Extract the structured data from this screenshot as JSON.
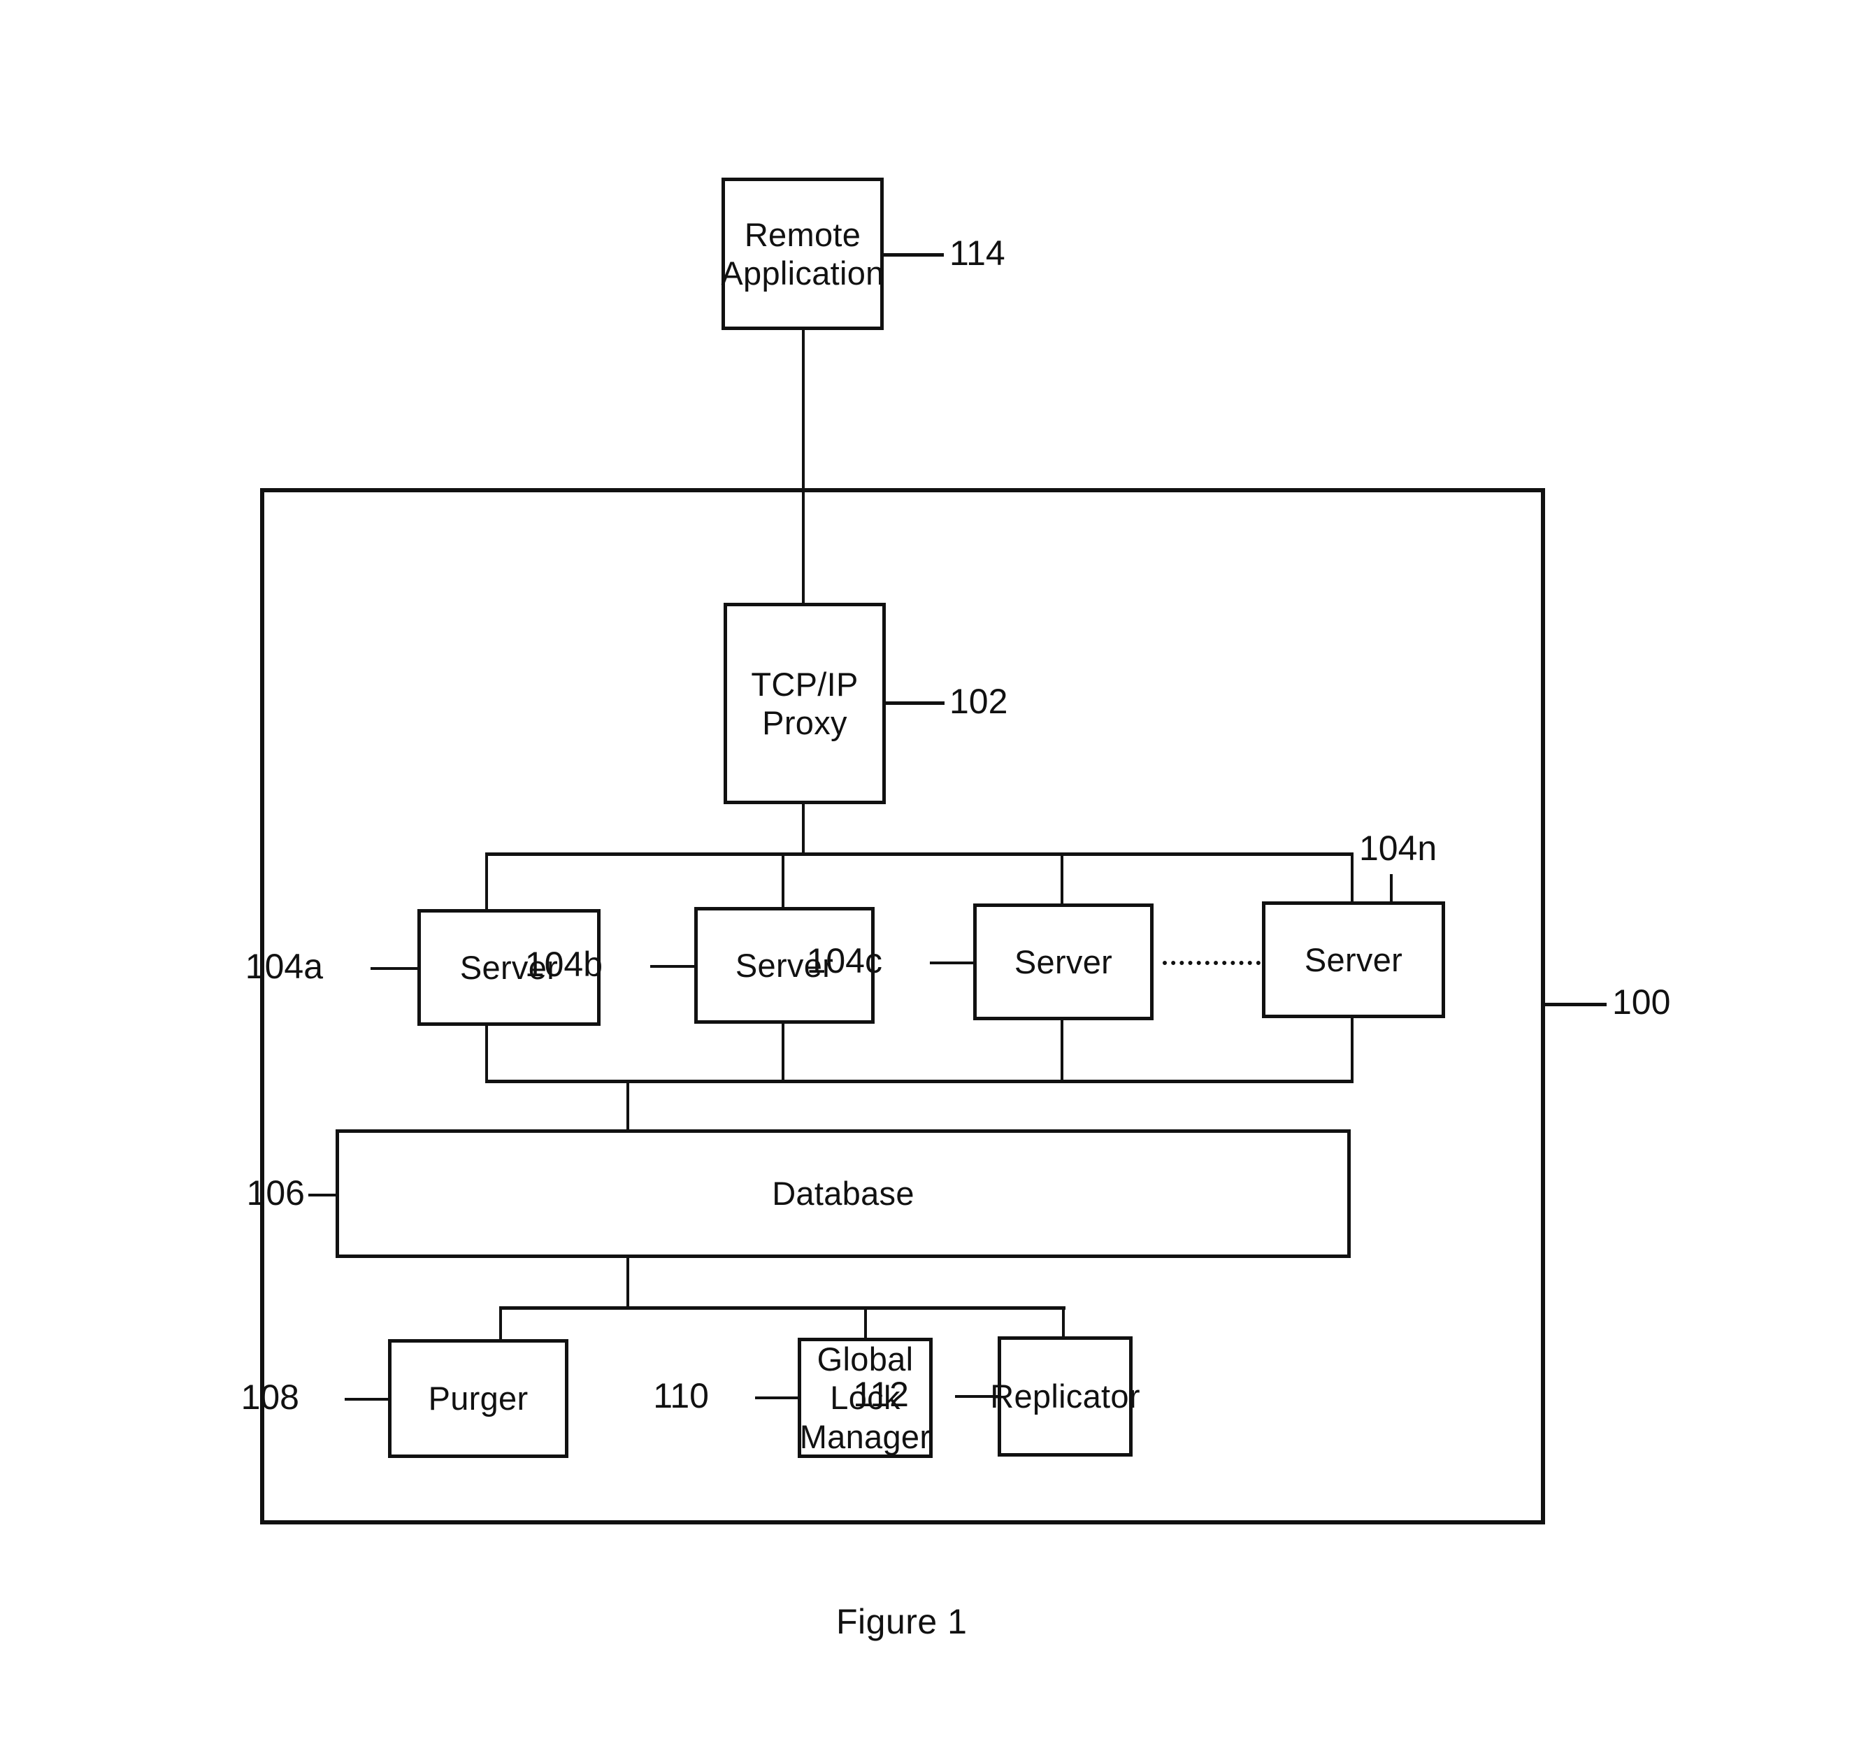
{
  "figure": {
    "caption": "Figure 1",
    "system_ref": "100"
  },
  "nodes": {
    "remote_application": {
      "label": "Remote\nApplication",
      "ref": "114"
    },
    "tcp_ip_proxy": {
      "label": "TCP/IP Proxy",
      "ref": "102"
    },
    "servers": [
      {
        "label": "Server",
        "ref": "104a"
      },
      {
        "label": "Server",
        "ref": "104b"
      },
      {
        "label": "Server",
        "ref": "104c"
      },
      {
        "label": "Server",
        "ref": "104n"
      }
    ],
    "database": {
      "label": "Database",
      "ref": "106"
    },
    "purger": {
      "label": "Purger",
      "ref": "108"
    },
    "global_lock_manager": {
      "label": "Global Lock\nManager",
      "ref": "110"
    },
    "replicator": {
      "label": "Replicator",
      "ref": "112"
    }
  },
  "colors": {
    "ink": "#111111",
    "paper": "#ffffff"
  }
}
